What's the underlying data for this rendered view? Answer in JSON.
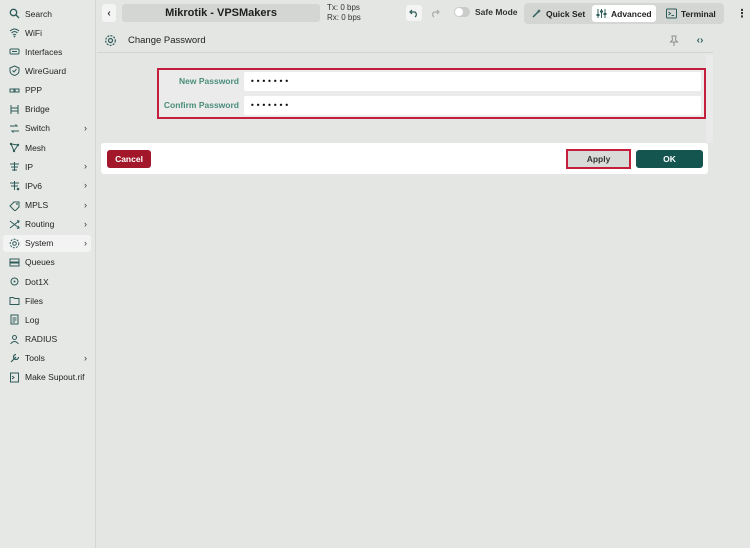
{
  "sidebar": {
    "items": [
      {
        "label": "Search",
        "icon": "search-icon",
        "chevron": false
      },
      {
        "label": "WiFi",
        "icon": "wifi-icon",
        "chevron": false
      },
      {
        "label": "Interfaces",
        "icon": "interfaces-icon",
        "chevron": false
      },
      {
        "label": "WireGuard",
        "icon": "wireguard-icon",
        "chevron": false
      },
      {
        "label": "PPP",
        "icon": "ppp-icon",
        "chevron": false
      },
      {
        "label": "Bridge",
        "icon": "bridge-icon",
        "chevron": false
      },
      {
        "label": "Switch",
        "icon": "switch-icon",
        "chevron": true
      },
      {
        "label": "Mesh",
        "icon": "mesh-icon",
        "chevron": false
      },
      {
        "label": "IP",
        "icon": "ip-icon",
        "chevron": true
      },
      {
        "label": "IPv6",
        "icon": "ipv6-icon",
        "chevron": true
      },
      {
        "label": "MPLS",
        "icon": "mpls-icon",
        "chevron": true
      },
      {
        "label": "Routing",
        "icon": "routing-icon",
        "chevron": true
      },
      {
        "label": "System",
        "icon": "system-gear-icon",
        "chevron": true,
        "active": true
      },
      {
        "label": "Queues",
        "icon": "queues-icon",
        "chevron": false
      },
      {
        "label": "Dot1X",
        "icon": "dot1x-icon",
        "chevron": false
      },
      {
        "label": "Files",
        "icon": "folder-icon",
        "chevron": false
      },
      {
        "label": "Log",
        "icon": "log-icon",
        "chevron": false
      },
      {
        "label": "RADIUS",
        "icon": "radius-icon",
        "chevron": false
      },
      {
        "label": "Tools",
        "icon": "tools-icon",
        "chevron": true
      },
      {
        "label": "Make Supout.rif",
        "icon": "terminal-file-icon",
        "chevron": false
      }
    ]
  },
  "topbar": {
    "title": "Mikrotik - VPSMakers",
    "tx": "Tx: 0 bps",
    "rx": "Rx: 0 bps",
    "safe_mode_label": "Safe Mode",
    "modes": {
      "quick_set": "Quick Set",
      "advanced": "Advanced",
      "terminal": "Terminal"
    },
    "active_mode": "Advanced"
  },
  "panel": {
    "title": "Change Password",
    "fields": {
      "new_password_label": "New Password",
      "new_password_value": "•••••••",
      "confirm_password_label": "Confirm Password",
      "confirm_password_value": "•••••••"
    },
    "buttons": {
      "cancel": "Cancel",
      "apply": "Apply",
      "ok": "OK"
    }
  },
  "colors": {
    "accent": "#2e5c58",
    "label_green": "#4a8d7b",
    "cancel_red": "#a3172a",
    "highlight_red": "#c31e3b",
    "ok_green": "#155550"
  }
}
